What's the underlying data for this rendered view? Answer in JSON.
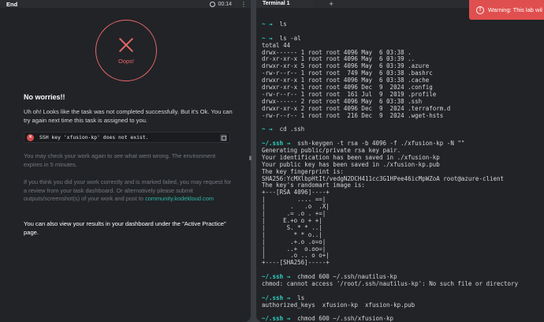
{
  "left_panel": {
    "tab_label": "End",
    "timer": "00:14",
    "oops_label": "Oops!",
    "heading": "No worries!!",
    "intro": "Uh oh! Looks like the task was not completed successfully. But it's Ok. You can try again next time this task is assigned to you.",
    "error_message": "SSH key 'xfusion-kp' does not exist.",
    "check_work": "You may check your work again to see what went wrong. The environment expires in 5 minutes.",
    "review_text": "If you think you did your work correctly and is marked failed, you may request for a review from your task dashboard. Or alternatively please submit outputs/screenshot(s) of your work and post to ",
    "community_link": "community.kodekloud.com",
    "results_text": "You can also view your results in your dashboard under the \"Active Practice\" page."
  },
  "right_panel": {
    "tab_label": "Terminal 1",
    "add_tab": "+",
    "terminal_lines": [
      {
        "prompt": "~ →",
        "text": "  ls"
      },
      {
        "prompt": "",
        "text": ""
      },
      {
        "prompt": "~ →",
        "text": "  ls -al"
      },
      {
        "prompt": "",
        "text": "total 44"
      },
      {
        "prompt": "",
        "text": "drwx------ 1 root root 4096 May  6 03:38 ."
      },
      {
        "prompt": "",
        "text": "dr-xr-xr-x 1 root root 4096 May  6 03:39 .."
      },
      {
        "prompt": "",
        "text": "drwxr-xr-x 5 root root 4096 May  6 03:39 .azure"
      },
      {
        "prompt": "",
        "text": "-rw-r--r-- 1 root root  749 May  6 03:38 .bashrc"
      },
      {
        "prompt": "",
        "text": "drwxr-xr-x 1 root root 4096 May  6 03:38 .cache"
      },
      {
        "prompt": "",
        "text": "drwxr-xr-x 1 root root 4096 Dec  9  2024 .config"
      },
      {
        "prompt": "",
        "text": "-rw-r--r-- 1 root root  161 Jul  9  2019 .profile"
      },
      {
        "prompt": "",
        "text": "drwx------ 2 root root 4096 May  6 03:38 .ssh"
      },
      {
        "prompt": "",
        "text": "drwxr-xr-x 2 root root 4096 Dec  9  2024 .terraform.d"
      },
      {
        "prompt": "",
        "text": "-rw-r--r-- 1 root root  216 Dec  9  2024 .wget-hsts"
      },
      {
        "prompt": "",
        "text": ""
      },
      {
        "prompt": "~ →",
        "text": "  cd .ssh"
      },
      {
        "prompt": "",
        "text": ""
      },
      {
        "prompt": "~/.ssh →",
        "text": "  ssh-keygen -t rsa -b 4096 -f ./xfusion-kp -N \"\""
      },
      {
        "prompt": "",
        "text": "Generating public/private rsa key pair."
      },
      {
        "prompt": "",
        "text": "Your identification has been saved in ./xfusion-kp"
      },
      {
        "prompt": "",
        "text": "Your public key has been saved in ./xfusion-kp.pub"
      },
      {
        "prompt": "",
        "text": "The key fingerprint is:"
      },
      {
        "prompt": "",
        "text": "SHA256:YcMXlbpHtIt/vedgN2DCH411cc3G1HPee46icMpWZoA root@azure-client"
      },
      {
        "prompt": "",
        "text": "The key's randomart image is:"
      },
      {
        "prompt": "",
        "text": "+---[RSA 4096]----+"
      },
      {
        "prompt": "",
        "text": "|         .... ==|"
      },
      {
        "prompt": "",
        "text": "|       .   .o  .X|"
      },
      {
        "prompt": "",
        "text": "|      .= .o . +=|"
      },
      {
        "prompt": "",
        "text": "|     E.+o o + +|"
      },
      {
        "prompt": "",
        "text": "|      S. * * ..|"
      },
      {
        "prompt": "",
        "text": "|        * * o..|"
      },
      {
        "prompt": "",
        "text": "|       .+.o .o=o|"
      },
      {
        "prompt": "",
        "text": "|      ..+  o.oo=|"
      },
      {
        "prompt": "",
        "text": "|       .o .. o o+|"
      },
      {
        "prompt": "",
        "text": "+----[SHA256]-----+"
      },
      {
        "prompt": "",
        "text": ""
      },
      {
        "prompt": "~/.ssh →",
        "text": "  chmod 600 ~/.ssh/nautilus-kp"
      },
      {
        "prompt": "",
        "text": "chmod: cannot access '/root/.ssh/nautilus-kp': No such file or directory"
      },
      {
        "prompt": "",
        "text": ""
      },
      {
        "prompt": "~/.ssh →",
        "text": "  ls"
      },
      {
        "prompt": "",
        "text": "authorized_keys  xfusion-kp  xfusion-kp.pub"
      },
      {
        "prompt": "",
        "text": ""
      },
      {
        "prompt": "~/.ssh →",
        "text": "  chmod 600 ~/.ssh/xfusion-kp"
      },
      {
        "prompt": "",
        "text": ""
      },
      {
        "prompt": "~/.ssh →",
        "text": "  "
      }
    ]
  },
  "toast": {
    "message": "Warning: This lab wil"
  },
  "colors": {
    "accent": "#2fd3c2",
    "error": "#e86767",
    "toast_bg": "#e04f4f"
  }
}
